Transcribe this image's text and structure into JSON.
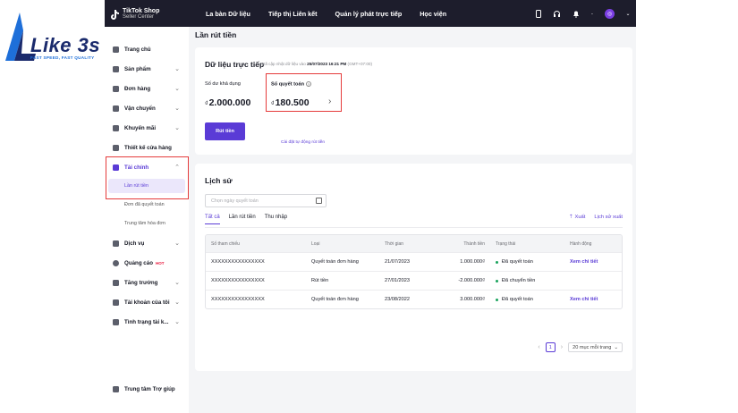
{
  "watermark": {
    "word": "Like 3s",
    "tagline": "FAST SPEED, FAST QUALITY"
  },
  "brand": {
    "name": "TikTok Shop",
    "sub": "Seller Center"
  },
  "nav": [
    "La bàn Dữ liệu",
    "Tiếp thị Liên kết",
    "Quản lý phát trực tiếp",
    "Học viện"
  ],
  "sidebar": {
    "items": [
      {
        "label": "Trang chủ",
        "chevron": false
      },
      {
        "label": "Sản phẩm",
        "chevron": true
      },
      {
        "label": "Đơn hàng",
        "chevron": true
      },
      {
        "label": "Vận chuyển",
        "chevron": true
      },
      {
        "label": "Khuyến mãi",
        "chevron": true
      },
      {
        "label": "Thiết kế cửa hàng",
        "chevron": false
      },
      {
        "label": "Tài chính",
        "chevron": true
      }
    ],
    "sub": [
      "Lần rút tiền",
      "Đơn đã quyết toán",
      "Trung tâm hóa đơn"
    ],
    "items2": [
      {
        "label": "Dịch vụ"
      },
      {
        "label": "Quảng cáo",
        "badge": "HOT"
      },
      {
        "label": "Tăng trưởng"
      },
      {
        "label": "Tài khoản của tôi"
      },
      {
        "label": "Tình trạng tài k..."
      }
    ],
    "help": "Trung tâm Trợ giúp"
  },
  "page_title": "Lần rút tiền",
  "realtime": {
    "title": "Dữ liệu trực tiếp",
    "updated_prefix": "Đã cập nhật dữ liệu vào",
    "updated_time": "25/07/2023 16:21 PM",
    "timezone": "(GMT+07:00)",
    "available_label": "Số dư khả dụng",
    "available_currency": "₫",
    "available_value": "2.000.000",
    "settle_label": "Số quyết toán",
    "settle_currency": "₫",
    "settle_value": "180.500",
    "withdraw_button": "Rút tiền",
    "auto_link": "Cài đặt tự động rút tiền"
  },
  "history": {
    "title": "Lịch sử",
    "date_placeholder": "Chọn ngày quyết toán",
    "tabs": [
      "Tất cả",
      "Lần rút tiền",
      "Thu nhập"
    ],
    "export": "Xuất",
    "export_history": "Lịch sử xuất",
    "columns": [
      "Số tham chiếu",
      "Loại",
      "Thời gian",
      "Thành tiền",
      "Trạng thái",
      "Hành động"
    ],
    "rows": [
      {
        "ref": "XXXXXXXXXXXXXXXX",
        "type": "Quyết toán đơn hàng",
        "time": "21/07/2023",
        "amount": "1.000.000₫",
        "status": "Đã quyết toán",
        "action": "Xem chi tiết"
      },
      {
        "ref": "XXXXXXXXXXXXXXXX",
        "type": "Rút tiền",
        "time": "27/01/2023",
        "amount": "-2.000.000₫",
        "status": "Đã chuyển tiền",
        "action": ""
      },
      {
        "ref": "XXXXXXXXXXXXXXXX",
        "type": "Quyết toán đơn hàng",
        "time": "23/08/2022",
        "amount": "3.000.000₫",
        "status": "Đã quyết toán",
        "action": "Xem chi tiết"
      }
    ],
    "page": "1",
    "page_size": "20 mục mỗi trang"
  },
  "colors": {
    "accent": "#5a3bd6",
    "highlight": "#e53b3b",
    "topbar": "#1d1d2c",
    "success": "#1aa35d"
  }
}
